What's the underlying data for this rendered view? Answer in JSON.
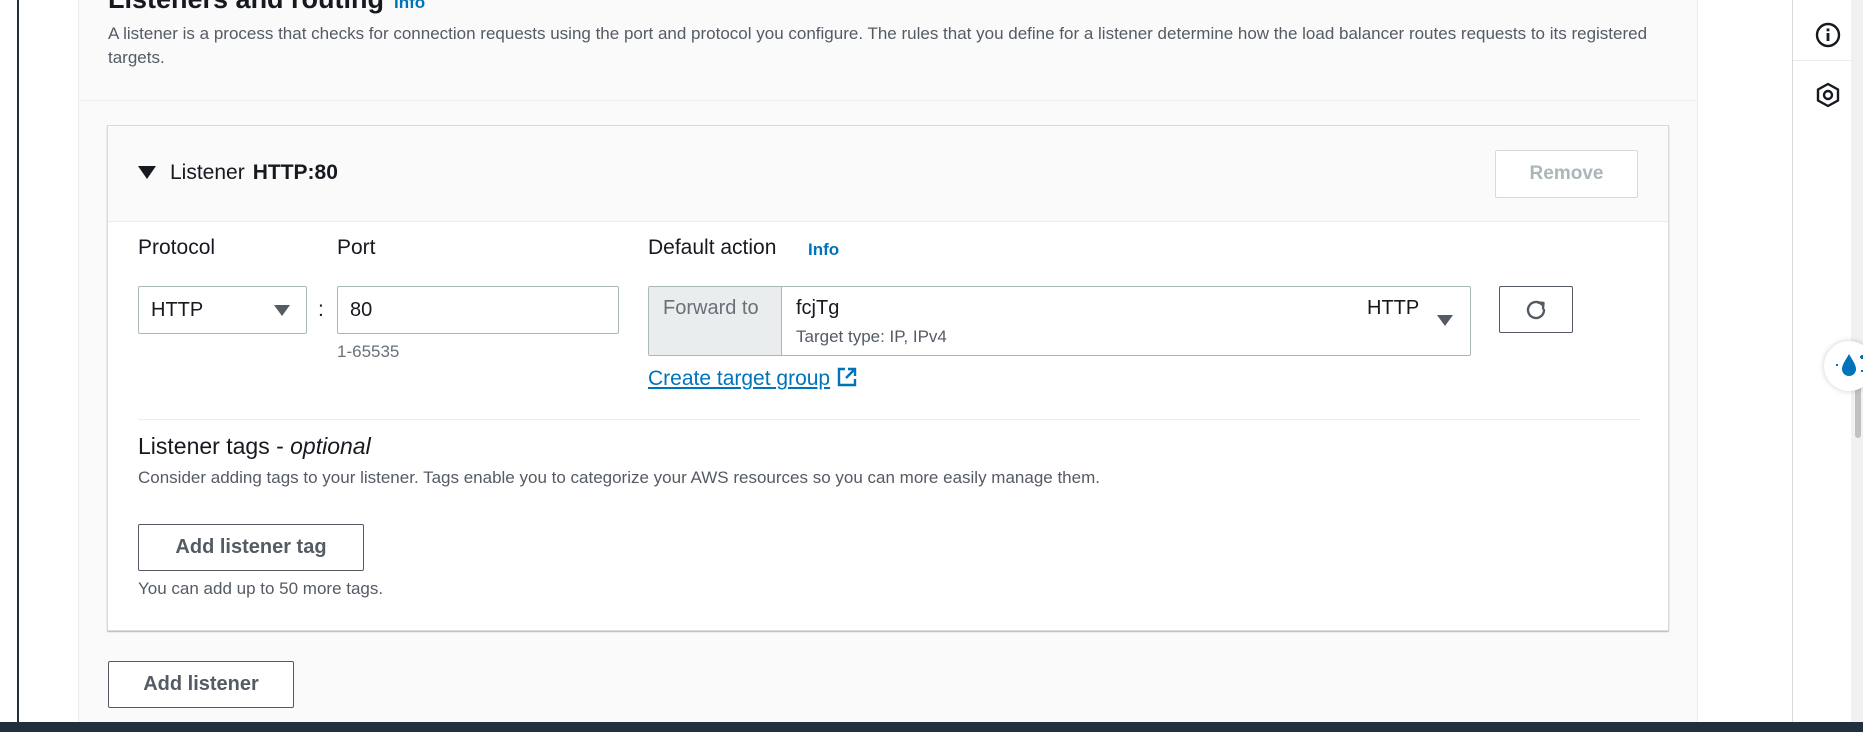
{
  "section": {
    "title": "Listeners and routing",
    "info_label": "Info",
    "description": "A listener is a process that checks for connection requests using the port and protocol you configure. The rules that you define for a listener determine how the load balancer routes requests to its registered targets."
  },
  "listener": {
    "label": "Listener",
    "name": "HTTP:80",
    "remove_label": "Remove",
    "protocol_label": "Protocol",
    "protocol_value": "HTTP",
    "port_label": "Port",
    "port_value": "80",
    "port_hint": "1-65535",
    "default_action_label": "Default action",
    "default_action_info": "Info",
    "forward_label": "Forward to",
    "target_group_name": "fcjTg",
    "target_group_protocol": "HTTP",
    "target_type": "Target type: IP, IPv4",
    "create_target_group_label": "Create target group"
  },
  "tags": {
    "title": "Listener tags - ",
    "title_optional": "optional",
    "description": "Consider adding tags to your listener. Tags enable you to categorize your AWS resources so you can more easily manage them.",
    "add_button": "Add listener tag",
    "hint": "You can add up to 50 more tags."
  },
  "actions": {
    "add_listener": "Add listener"
  },
  "icons": {
    "expand": "caret-down-icon",
    "protocol_select": "triangle-down-icon",
    "target_select": "triangle-down-icon",
    "refresh": "refresh-icon",
    "external": "external-link-icon",
    "rail_info": "info-circle-icon",
    "rail_hex": "hexagon-icon",
    "floating": "water-drop-icon"
  },
  "colors": {
    "link": "#0073bb",
    "text": "#16191f",
    "muted": "#545b64",
    "disabled": "#aab7b8",
    "dark_bar": "#232f3e"
  }
}
